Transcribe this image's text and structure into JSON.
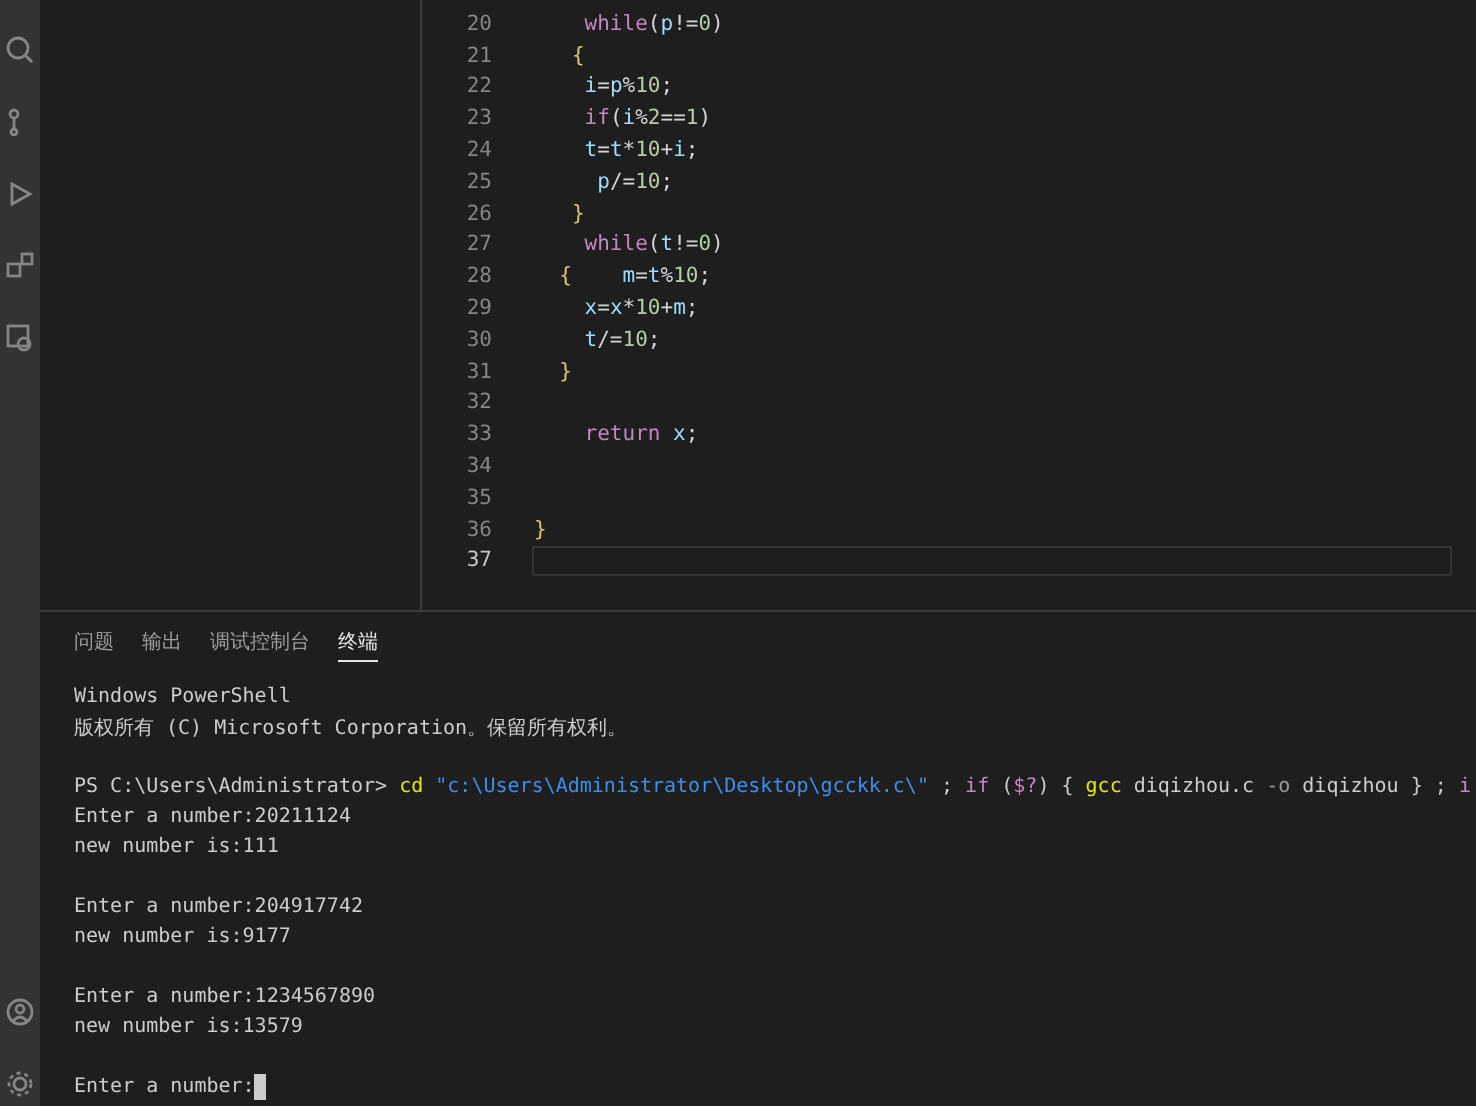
{
  "editor": {
    "lines": [
      {
        "number": "20",
        "current": false,
        "tokens": [
          {
            "text": "    while",
            "kind": "keyword"
          },
          {
            "text": "(",
            "kind": "punct"
          },
          {
            "text": "p",
            "kind": "var"
          },
          {
            "text": "!=",
            "kind": "punct"
          },
          {
            "text": "0",
            "kind": "num"
          },
          {
            "text": ")",
            "kind": "punct"
          }
        ]
      },
      {
        "number": "21",
        "current": false,
        "tokens": [
          {
            "text": "   {",
            "kind": "brace"
          }
        ]
      },
      {
        "number": "22",
        "current": false,
        "tokens": [
          {
            "text": "    i",
            "kind": "var"
          },
          {
            "text": "=",
            "kind": "punct"
          },
          {
            "text": "p",
            "kind": "var"
          },
          {
            "text": "%",
            "kind": "punct"
          },
          {
            "text": "10",
            "kind": "num"
          },
          {
            "text": ";",
            "kind": "punct"
          }
        ]
      },
      {
        "number": "23",
        "current": false,
        "tokens": [
          {
            "text": "    if",
            "kind": "keyword"
          },
          {
            "text": "(",
            "kind": "punct"
          },
          {
            "text": "i",
            "kind": "var"
          },
          {
            "text": "%",
            "kind": "punct"
          },
          {
            "text": "2",
            "kind": "num"
          },
          {
            "text": "==",
            "kind": "punct"
          },
          {
            "text": "1",
            "kind": "num"
          },
          {
            "text": ")",
            "kind": "punct"
          }
        ]
      },
      {
        "number": "24",
        "current": false,
        "tokens": [
          {
            "text": "    t",
            "kind": "var"
          },
          {
            "text": "=",
            "kind": "punct"
          },
          {
            "text": "t",
            "kind": "var"
          },
          {
            "text": "*",
            "kind": "punct"
          },
          {
            "text": "10",
            "kind": "num"
          },
          {
            "text": "+",
            "kind": "punct"
          },
          {
            "text": "i",
            "kind": "var"
          },
          {
            "text": ";",
            "kind": "punct"
          }
        ]
      },
      {
        "number": "25",
        "current": false,
        "tokens": [
          {
            "text": "     p",
            "kind": "var"
          },
          {
            "text": "/=",
            "kind": "punct"
          },
          {
            "text": "10",
            "kind": "num"
          },
          {
            "text": ";",
            "kind": "punct"
          }
        ]
      },
      {
        "number": "26",
        "current": false,
        "tokens": [
          {
            "text": "   }",
            "kind": "brace"
          }
        ]
      },
      {
        "number": "27",
        "current": false,
        "tokens": [
          {
            "text": "    while",
            "kind": "keyword"
          },
          {
            "text": "(",
            "kind": "punct"
          },
          {
            "text": "t",
            "kind": "var"
          },
          {
            "text": "!=",
            "kind": "punct"
          },
          {
            "text": "0",
            "kind": "num"
          },
          {
            "text": ")",
            "kind": "punct"
          }
        ]
      },
      {
        "number": "28",
        "current": false,
        "tokens": [
          {
            "text": "  {",
            "kind": "brace"
          },
          {
            "text": "    m",
            "kind": "var"
          },
          {
            "text": "=",
            "kind": "punct"
          },
          {
            "text": "t",
            "kind": "var"
          },
          {
            "text": "%",
            "kind": "punct"
          },
          {
            "text": "10",
            "kind": "num"
          },
          {
            "text": ";",
            "kind": "punct"
          }
        ]
      },
      {
        "number": "29",
        "current": false,
        "tokens": [
          {
            "text": "    x",
            "kind": "var"
          },
          {
            "text": "=",
            "kind": "punct"
          },
          {
            "text": "x",
            "kind": "var"
          },
          {
            "text": "*",
            "kind": "punct"
          },
          {
            "text": "10",
            "kind": "num"
          },
          {
            "text": "+",
            "kind": "punct"
          },
          {
            "text": "m",
            "kind": "var"
          },
          {
            "text": ";",
            "kind": "punct"
          }
        ]
      },
      {
        "number": "30",
        "current": false,
        "tokens": [
          {
            "text": "    t",
            "kind": "var"
          },
          {
            "text": "/=",
            "kind": "punct"
          },
          {
            "text": "10",
            "kind": "num"
          },
          {
            "text": ";",
            "kind": "punct"
          }
        ]
      },
      {
        "number": "31",
        "current": false,
        "tokens": [
          {
            "text": "  }",
            "kind": "brace"
          }
        ]
      },
      {
        "number": "32",
        "current": false
      },
      {
        "number": "33",
        "current": false,
        "tokens": [
          {
            "text": "    return",
            "kind": "keyword"
          },
          {
            "text": " x",
            "kind": "var"
          },
          {
            "text": ";",
            "kind": "punct"
          }
        ]
      },
      {
        "number": "34",
        "current": false
      },
      {
        "number": "35",
        "current": false
      },
      {
        "number": "36",
        "current": false,
        "tokens": [
          {
            "text": "}",
            "kind": "brace"
          }
        ]
      },
      {
        "number": "37",
        "current": true
      }
    ]
  },
  "panel": {
    "tabs": [
      {
        "label": "问题",
        "selected": false
      },
      {
        "label": "输出",
        "selected": false
      },
      {
        "label": "调试控制台",
        "selected": false
      },
      {
        "label": "终端",
        "selected": true
      }
    ],
    "terminal": [
      {
        "lines": [
          {
            "segments": [
              {
                "text": "Windows PowerShell",
                "kind": "plain"
              }
            ]
          },
          {
            "segments": [
              {
                "text": "版权所有 (C) Microsoft Corporation。保留所有权利。",
                "kind": "plain"
              }
            ]
          }
        ]
      },
      {
        "lines": [
          {
            "segments": [
              {
                "text": "PS C:\\Users\\Administrator> ",
                "kind": "plain"
              },
              {
                "text": "cd",
                "kind": "command"
              },
              {
                "text": " \"c:\\Users\\Administrator\\Desktop\\gcckk.c\\\"",
                "kind": "string"
              },
              {
                "text": " ; ",
                "kind": "plain"
              },
              {
                "text": "if",
                "kind": "keyword"
              },
              {
                "text": " (",
                "kind": "plain"
              },
              {
                "text": "$?",
                "kind": "keyword"
              },
              {
                "text": ") { ",
                "kind": "plain"
              },
              {
                "text": "gcc",
                "kind": "command"
              },
              {
                "text": " diqizhou.c ",
                "kind": "plain"
              },
              {
                "text": "-o",
                "kind": "flag"
              },
              {
                "text": " diqizhou } ; ",
                "kind": "plain"
              },
              {
                "text": "i",
                "kind": "keyword"
              }
            ]
          },
          {
            "segments": [
              {
                "text": "Enter a number:20211124",
                "kind": "plain"
              }
            ]
          },
          {
            "segments": [
              {
                "text": "new number is:111",
                "kind": "plain"
              }
            ]
          }
        ]
      },
      {
        "lines": [
          {
            "segments": [
              {
                "text": "Enter a number:204917742",
                "kind": "plain"
              }
            ]
          },
          {
            "segments": [
              {
                "text": "new number is:9177",
                "kind": "plain"
              }
            ]
          }
        ]
      },
      {
        "lines": [
          {
            "segments": [
              {
                "text": "Enter a number:1234567890",
                "kind": "plain"
              }
            ]
          },
          {
            "segments": [
              {
                "text": "new number is:13579",
                "kind": "plain"
              }
            ]
          }
        ]
      },
      {
        "lines": [
          {
            "segments": [
              {
                "text": "Enter a number:",
                "kind": "plain"
              }
            ],
            "cursor": true
          }
        ]
      }
    ]
  }
}
